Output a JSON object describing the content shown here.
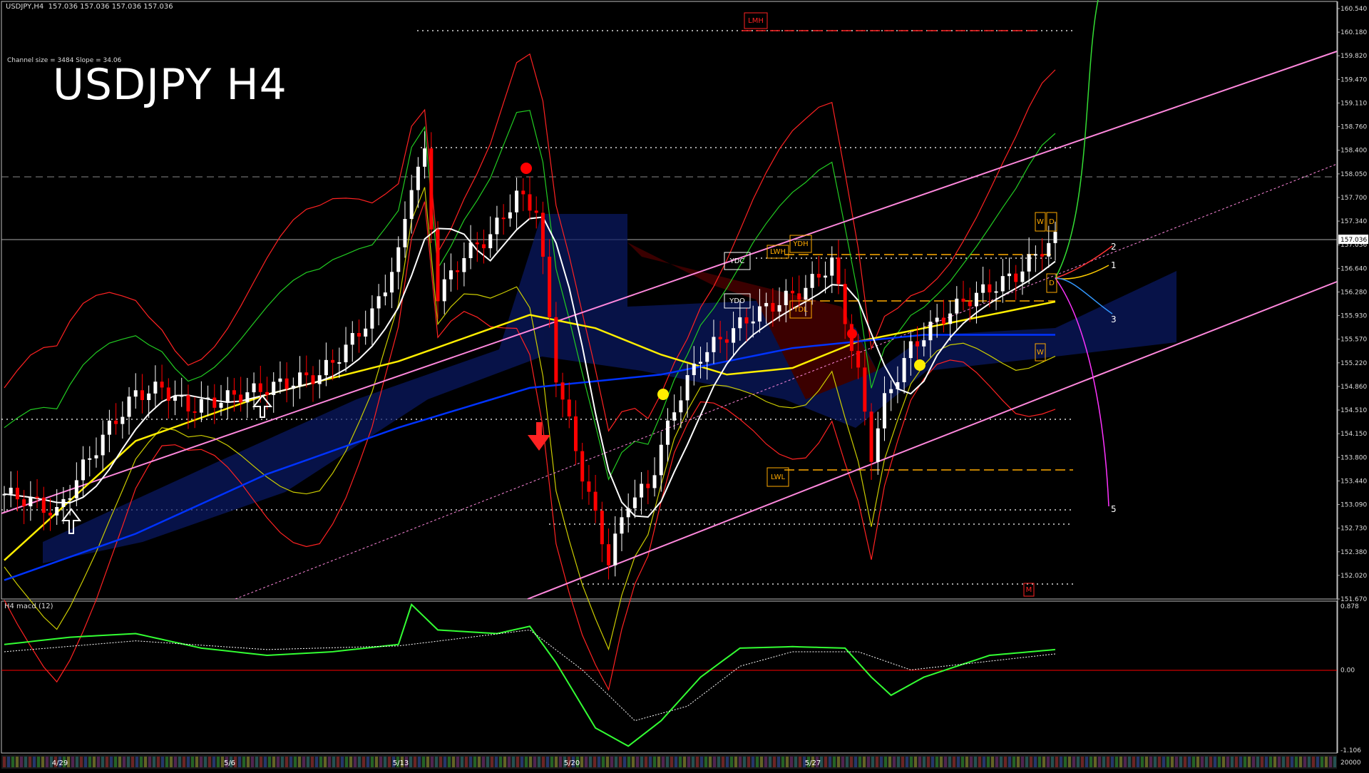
{
  "header": {
    "symbol_line": "USDJPY,H4  157.036 157.036 157.036 157.036"
  },
  "channel_info": "Channel size = 3484 Slope = 34.06",
  "title": "USDJPY H4",
  "indicator_title": "H4  macd (12)",
  "price_scale": {
    "labels": [
      "160.540",
      "160.180",
      "159.820",
      "159.470",
      "159.110",
      "158.760",
      "158.400",
      "158.050",
      "157.700",
      "157.340",
      "157.036",
      "156.640",
      "156.280",
      "155.930",
      "155.570",
      "155.220",
      "154.860",
      "154.510",
      "154.150",
      "153.800",
      "153.440",
      "153.090",
      "152.730",
      "152.380",
      "152.020",
      "151.670"
    ],
    "current": "157.036",
    "min": 151.67,
    "max": 160.54
  },
  "macd_scale": {
    "labels": [
      "0.878",
      "0.00",
      "-1.106"
    ],
    "max": 0.878,
    "min": -1.106
  },
  "date_labels": [
    "4/29",
    "5/6",
    "5/13",
    "5/20",
    "5/27"
  ],
  "footer_right": "20000",
  "level_labels": [
    "LMH",
    "YDC",
    "LWH",
    "YDH",
    "YDO",
    "YDL",
    "LWL",
    "M",
    "W",
    "D",
    "W",
    "D"
  ],
  "projection_labels": [
    "2",
    "1",
    "3",
    "5"
  ],
  "colors": {
    "background": "#000000",
    "bull": "#ffffff",
    "bear": "#ff0000",
    "channel": "#ff88dd",
    "ma_yellow": "#ffee00",
    "ma_blue": "#0033ff",
    "ma_white": "#ffffff",
    "macd_green": "#33ff33",
    "macd_pink": "#ff8888",
    "signal_white": "#ffffff",
    "level_orange": "#ffaa00"
  },
  "chart_data": {
    "type": "candlestick",
    "title": "USDJPY H4",
    "x_dates": [
      "4/29",
      "5/6",
      "5/13",
      "5/20",
      "5/27"
    ],
    "ylim": [
      151.67,
      160.54
    ],
    "close_path": [
      [
        0,
        153.2
      ],
      [
        4,
        153.1
      ],
      [
        8,
        152.9
      ],
      [
        12,
        153.6
      ],
      [
        16,
        154.2
      ],
      [
        20,
        154.7
      ],
      [
        24,
        154.8
      ],
      [
        28,
        154.5
      ],
      [
        32,
        154.6
      ],
      [
        36,
        154.7
      ],
      [
        40,
        154.8
      ],
      [
        44,
        154.9
      ],
      [
        48,
        155.0
      ],
      [
        52,
        155.4
      ],
      [
        56,
        155.9
      ],
      [
        60,
        156.8
      ],
      [
        62,
        157.9
      ],
      [
        64,
        158.3
      ],
      [
        66,
        156.2
      ],
      [
        70,
        156.8
      ],
      [
        74,
        157.1
      ],
      [
        78,
        157.7
      ],
      [
        81,
        157.5
      ],
      [
        84,
        155.0
      ],
      [
        88,
        153.5
      ],
      [
        92,
        152.2
      ],
      [
        95,
        153.1
      ],
      [
        98,
        153.3
      ],
      [
        102,
        154.5
      ],
      [
        106,
        155.3
      ],
      [
        110,
        155.6
      ],
      [
        114,
        155.9
      ],
      [
        118,
        156.1
      ],
      [
        122,
        156.3
      ],
      [
        126,
        156.7
      ],
      [
        130,
        155.0
      ],
      [
        132,
        153.8
      ],
      [
        134,
        154.6
      ],
      [
        138,
        155.4
      ],
      [
        142,
        155.8
      ],
      [
        146,
        156.1
      ],
      [
        150,
        156.3
      ],
      [
        154,
        156.5
      ],
      [
        158,
        156.9
      ],
      [
        160,
        157.036
      ]
    ],
    "ma_yellow": [
      [
        0,
        152.2
      ],
      [
        20,
        154.0
      ],
      [
        40,
        154.7
      ],
      [
        60,
        155.2
      ],
      [
        80,
        155.9
      ],
      [
        90,
        155.7
      ],
      [
        100,
        155.3
      ],
      [
        110,
        155.0
      ],
      [
        120,
        155.1
      ],
      [
        130,
        155.5
      ],
      [
        145,
        155.8
      ],
      [
        160,
        156.1
      ]
    ],
    "ma_blue": [
      [
        0,
        151.9
      ],
      [
        20,
        152.6
      ],
      [
        40,
        153.5
      ],
      [
        60,
        154.2
      ],
      [
        80,
        154.8
      ],
      [
        100,
        155.0
      ],
      [
        120,
        155.4
      ],
      [
        140,
        155.6
      ],
      [
        160,
        155.6
      ]
    ],
    "macd": [
      [
        0,
        0.35
      ],
      [
        10,
        0.45
      ],
      [
        20,
        0.5
      ],
      [
        30,
        0.3
      ],
      [
        40,
        0.2
      ],
      [
        50,
        0.25
      ],
      [
        60,
        0.35
      ],
      [
        62,
        0.9
      ],
      [
        66,
        0.55
      ],
      [
        75,
        0.5
      ],
      [
        80,
        0.6
      ],
      [
        84,
        0.1
      ],
      [
        90,
        -0.8
      ],
      [
        95,
        -1.05
      ],
      [
        100,
        -0.7
      ],
      [
        106,
        -0.1
      ],
      [
        112,
        0.3
      ],
      [
        120,
        0.32
      ],
      [
        128,
        0.3
      ],
      [
        132,
        -0.1
      ],
      [
        135,
        -0.35
      ],
      [
        140,
        -0.1
      ],
      [
        150,
        0.2
      ],
      [
        160,
        0.28
      ]
    ],
    "signal": [
      [
        0,
        0.25
      ],
      [
        20,
        0.4
      ],
      [
        40,
        0.28
      ],
      [
        60,
        0.33
      ],
      [
        80,
        0.55
      ],
      [
        88,
        0.0
      ],
      [
        96,
        -0.7
      ],
      [
        104,
        -0.5
      ],
      [
        112,
        0.05
      ],
      [
        120,
        0.25
      ],
      [
        130,
        0.25
      ],
      [
        138,
        0.0
      ],
      [
        148,
        0.1
      ],
      [
        160,
        0.22
      ]
    ]
  }
}
